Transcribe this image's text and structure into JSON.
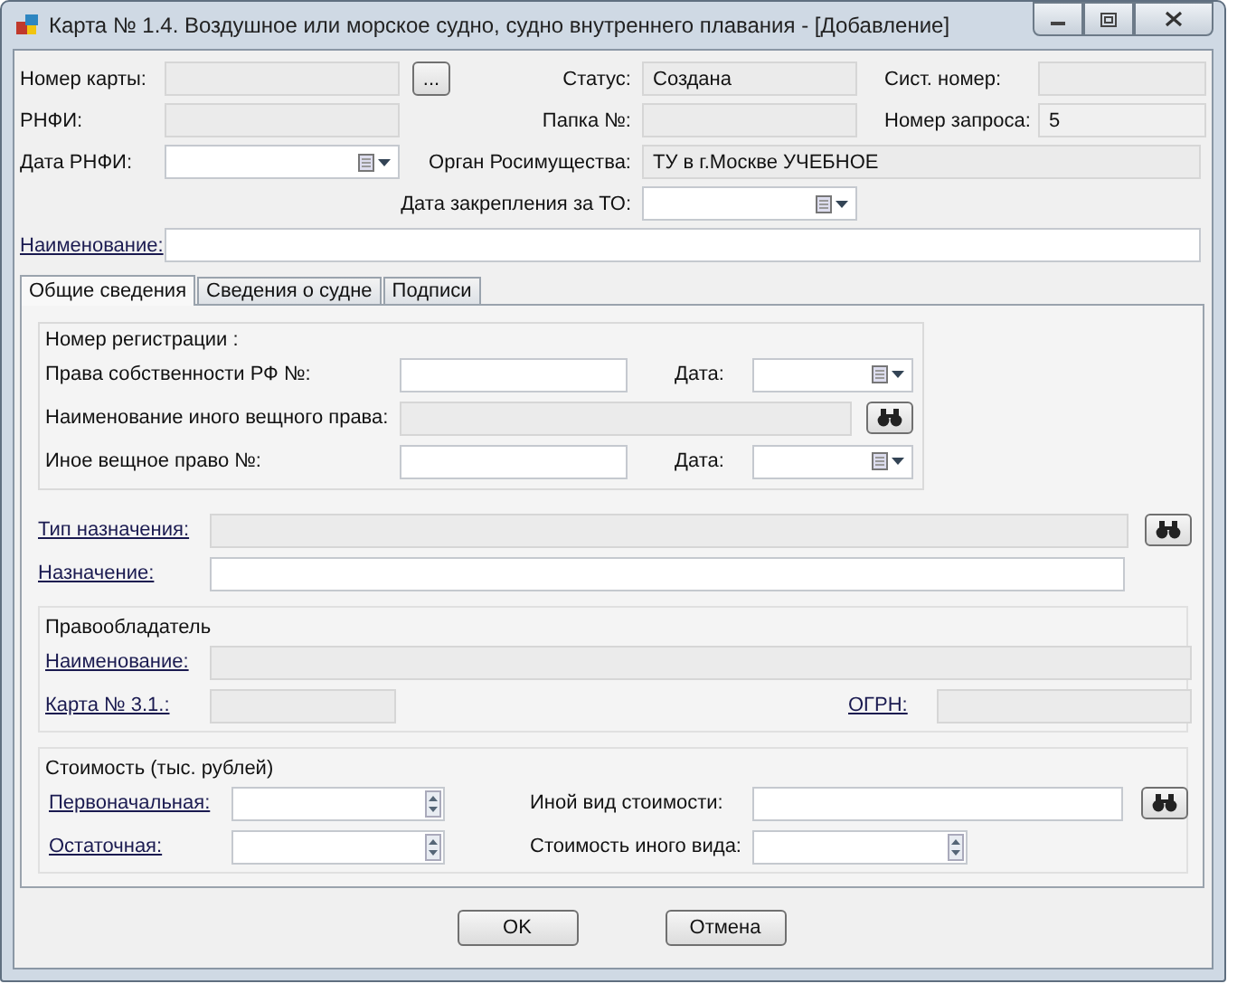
{
  "window": {
    "title": "Карта  № 1.4. Воздушное или морское судно, судно внутреннего плавания - [Добавление]"
  },
  "header": {
    "card_number": {
      "label": "Номер карты:",
      "disabled": true,
      "button": "..."
    },
    "status": {
      "label": "Статус:",
      "value": "Создана",
      "disabled": true
    },
    "sys_number": {
      "label": "Сист. номер:",
      "disabled": true
    },
    "rnfi": {
      "label": "РНФИ:",
      "disabled": true
    },
    "folder": {
      "label": "Папка №:",
      "disabled": true
    },
    "request_number": {
      "label": "Номер запроса:",
      "value": "5",
      "disabled": true
    },
    "rnfi_date": {
      "label": "Дата РНФИ:",
      "disabled": false
    },
    "agency": {
      "label": "Орган Росимущества:",
      "value": "ТУ в г.Москве УЧЕБНОЕ",
      "disabled": true
    },
    "assign_date": {
      "label": "Дата закрепления за ТО:",
      "disabled": false
    },
    "name": {
      "label": "Наименование:",
      "link": true,
      "disabled": false
    }
  },
  "tabs": [
    {
      "label": "Общие сведения",
      "selected": true
    },
    {
      "label": "Сведения о судне",
      "selected": false
    },
    {
      "label": "Подписи",
      "selected": false
    }
  ],
  "registration": {
    "title": "Номер регистрации :",
    "ownership": {
      "label": "Права собственности РФ №:",
      "disabled": false
    },
    "ownership_date": {
      "label": "Дата:",
      "disabled": false
    },
    "other_right_name": {
      "label": "Наименование иного вещного права:",
      "disabled": true
    },
    "other_right": {
      "label": "Иное вещное право  №:",
      "disabled": false
    },
    "other_right_date": {
      "label": "Дата:",
      "disabled": false
    }
  },
  "purpose_type": {
    "label": "Тип назначения:",
    "link": true,
    "disabled": true
  },
  "purpose": {
    "label": "Назначение:",
    "link": true,
    "disabled": false
  },
  "holder": {
    "title": "Правообладатель",
    "name": {
      "label": "Наименование:",
      "link": true,
      "disabled": true
    },
    "card": {
      "label": "Карта № 3.1.:",
      "link": true,
      "disabled": true
    },
    "ogrn": {
      "label": "ОГРН:",
      "link": true,
      "disabled": true
    }
  },
  "cost": {
    "title": "Стоимость (тыс. рублей)",
    "initial": {
      "label": "Первоначальная:",
      "link": true,
      "disabled": false
    },
    "residual": {
      "label": "Остаточная:",
      "link": true,
      "disabled": false
    },
    "other_kind": {
      "label": "Иной вид стоимости:",
      "disabled": false
    },
    "other_value": {
      "label": "Стоимость иного вида:",
      "disabled": false
    }
  },
  "buttons": [
    "OK",
    "Отмена"
  ]
}
